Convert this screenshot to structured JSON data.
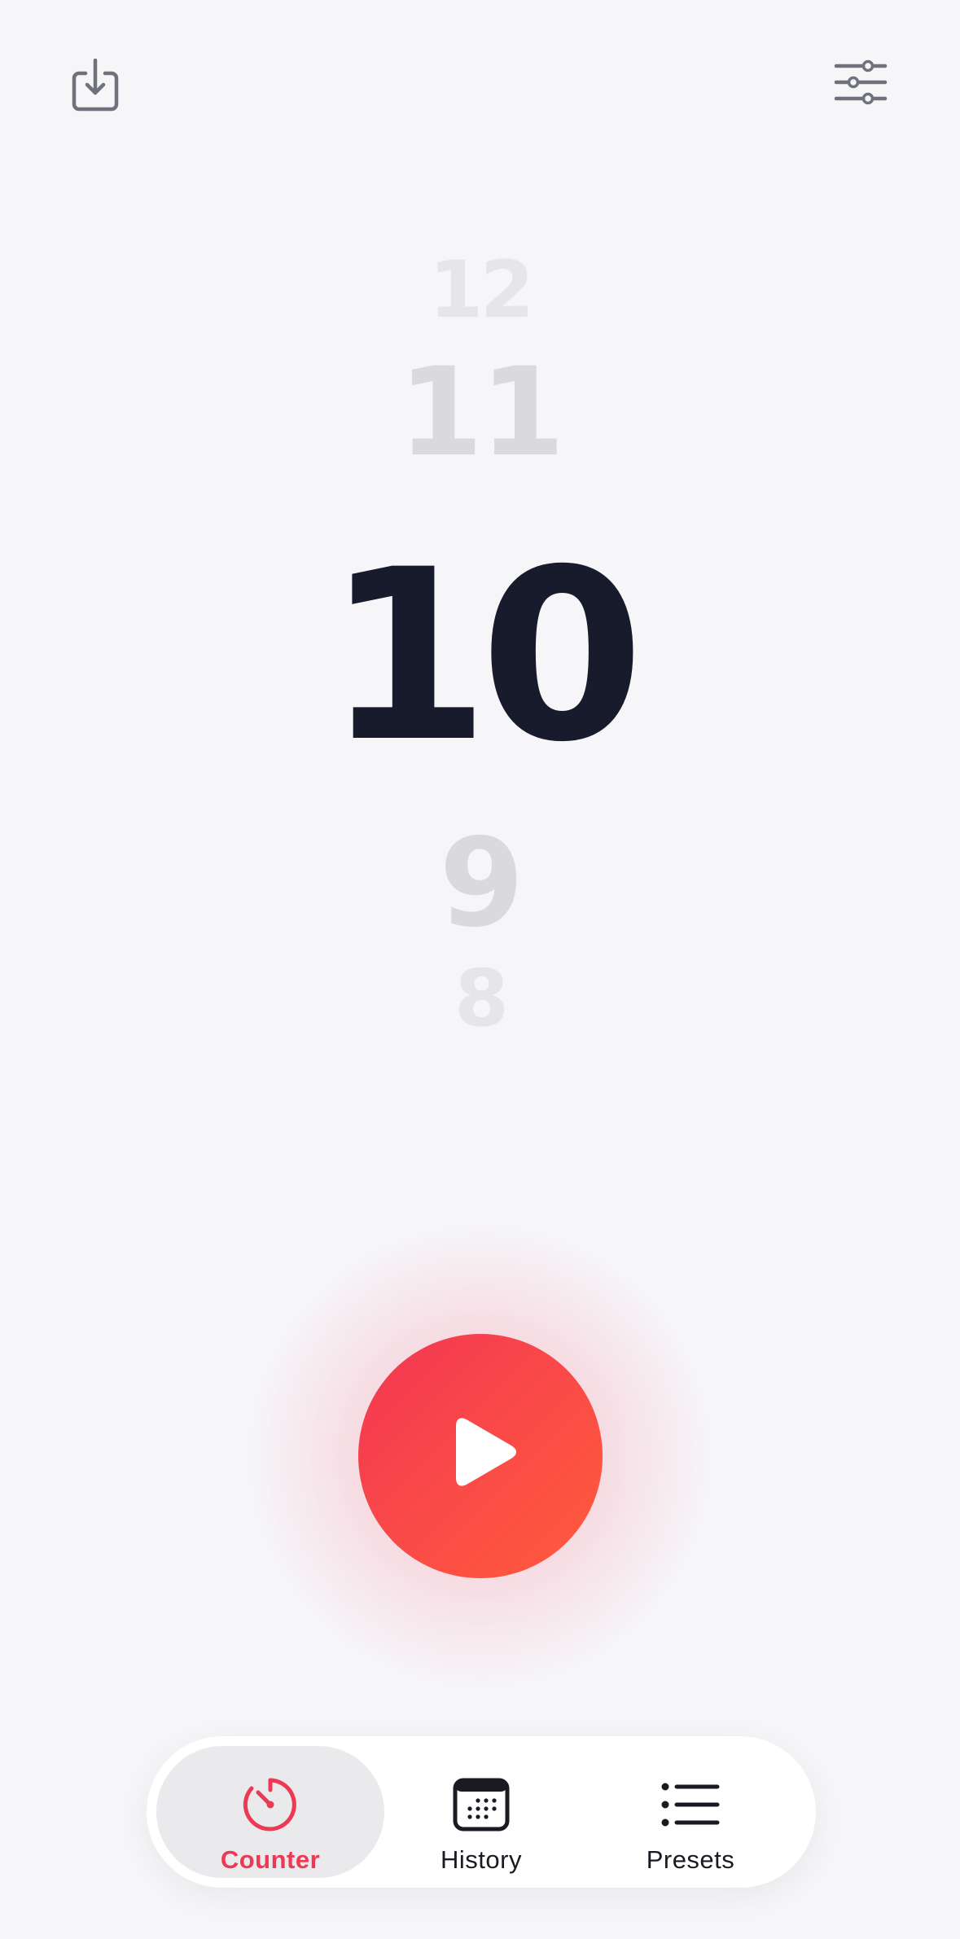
{
  "header": {
    "export_icon": "square-and-arrow-down-icon",
    "settings_icon": "sliders-icon"
  },
  "picker": {
    "values": {
      "far_top": "12",
      "near_top": "11",
      "current": "10",
      "near_bottom": "9",
      "far_bottom": "8"
    }
  },
  "play_button": {
    "icon": "play-icon",
    "gradient_start": "#f23653",
    "gradient_end": "#ff5b3b"
  },
  "tabbar": {
    "tabs": [
      {
        "label": "Counter",
        "icon": "timer-icon",
        "active": true
      },
      {
        "label": "History",
        "icon": "calendar-icon",
        "active": false
      },
      {
        "label": "Presets",
        "icon": "list-icon",
        "active": false
      }
    ]
  },
  "colors": {
    "accent": "#ec3a54",
    "background": "#f6f6f9",
    "current_number": "#181b2c",
    "faded_number": "#d9d9de",
    "icon_gray": "#6f717c"
  }
}
